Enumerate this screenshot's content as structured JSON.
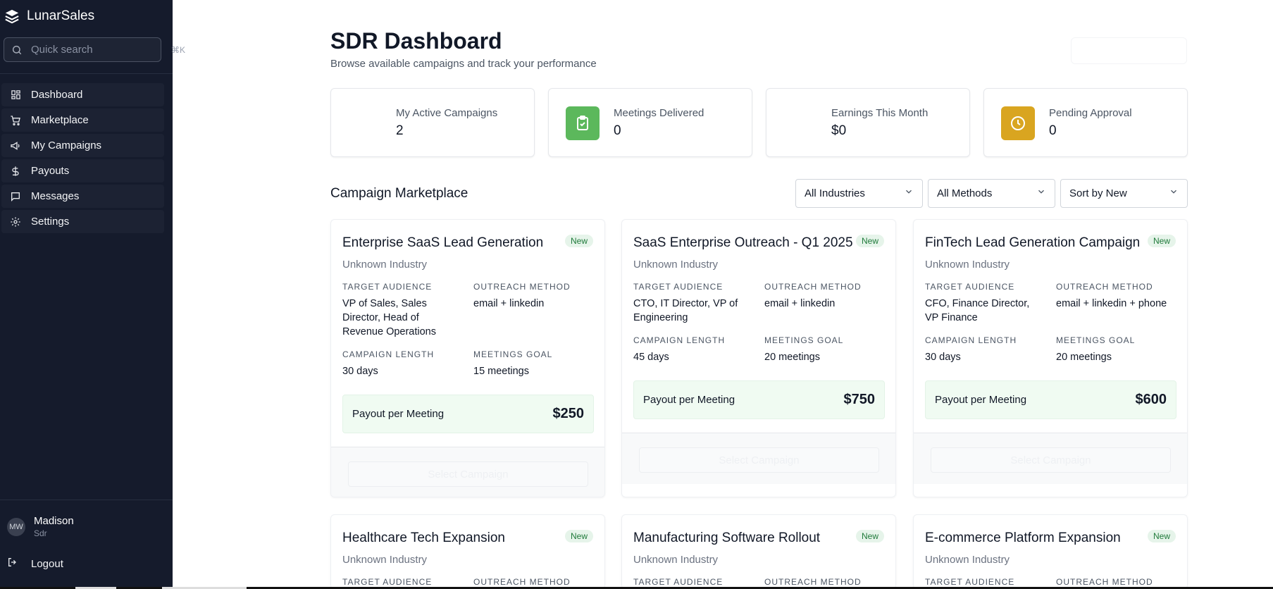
{
  "sidebar": {
    "brand": "LunarSales",
    "search": {
      "placeholder": "Quick search",
      "shortcut": "⌘K"
    },
    "nav": [
      {
        "label": "Dashboard",
        "icon": "dashboard-grid-icon"
      },
      {
        "label": "Marketplace",
        "icon": "cart-icon"
      },
      {
        "label": "My Campaigns",
        "icon": "megaphone-icon"
      },
      {
        "label": "Payouts",
        "icon": "dollar-icon"
      },
      {
        "label": "Messages",
        "icon": "message-icon"
      },
      {
        "label": "Settings",
        "icon": "gear-icon"
      }
    ],
    "user": {
      "initials": "MW",
      "name": "Madison",
      "role": "Sdr"
    },
    "logout": "Logout"
  },
  "header": {
    "title": "SDR Dashboard",
    "subtitle": "Browse available campaigns and track your performance"
  },
  "stats": [
    {
      "label": "My Active Campaigns",
      "value": "2",
      "icon": "",
      "color": ""
    },
    {
      "label": "Meetings Delivered",
      "value": "0",
      "icon": "clipboard-check-icon",
      "color": "#5cb85c"
    },
    {
      "label": "Earnings This Month",
      "value": "$0",
      "icon": "",
      "color": ""
    },
    {
      "label": "Pending Approval",
      "value": "0",
      "icon": "clock-icon",
      "color": "#d9a520"
    }
  ],
  "marketplace": {
    "title": "Campaign Marketplace",
    "filters": {
      "industry": "All Industries",
      "method": "All Methods",
      "sort": "Sort by New"
    },
    "labels": {
      "audience": "TARGET AUDIENCE",
      "method": "OUTREACH METHOD",
      "length": "CAMPAIGN LENGTH",
      "goal": "MEETINGS GOAL",
      "payout": "Payout per Meeting",
      "select": "Select Campaign",
      "new": "New"
    },
    "campaigns": [
      {
        "title": "Enterprise SaaS Lead Generation",
        "industry": "Unknown Industry",
        "audience": "VP of Sales, Sales Director, Head of Revenue Operations",
        "method": "email + linkedin",
        "length": "30 days",
        "goal": "15 meetings",
        "payout": "$250"
      },
      {
        "title": "SaaS Enterprise Outreach - Q1 2025",
        "industry": "Unknown Industry",
        "audience": "CTO, IT Director, VP of Engineering",
        "method": "email + linkedin",
        "length": "45 days",
        "goal": "20 meetings",
        "payout": "$750"
      },
      {
        "title": "FinTech Lead Generation Campaign",
        "industry": "Unknown Industry",
        "audience": "CFO, Finance Director, VP Finance",
        "method": "email + linkedin + phone",
        "length": "30 days",
        "goal": "20 meetings",
        "payout": "$600"
      },
      {
        "title": "Healthcare Tech Expansion",
        "industry": "Unknown Industry"
      },
      {
        "title": "Manufacturing Software Rollout",
        "industry": "Unknown Industry"
      },
      {
        "title": "E-commerce Platform Expansion",
        "industry": "Unknown Industry"
      }
    ]
  }
}
